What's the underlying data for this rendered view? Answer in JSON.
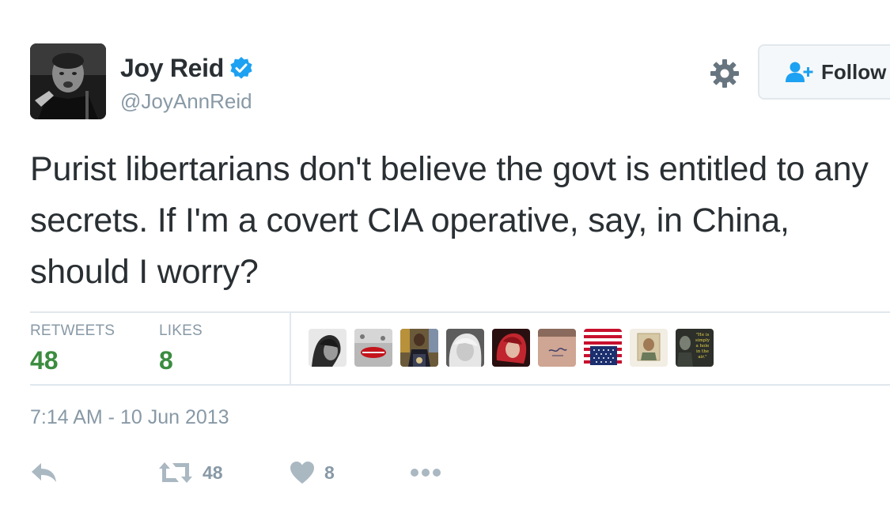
{
  "author": {
    "display_name": "Joy Reid",
    "handle": "@JoyAnnReid",
    "verified": true
  },
  "header": {
    "follow_label": "Follow"
  },
  "tweet": {
    "text": "Purist libertarians don't believe the govt is entitled to any secrets. If I'm a covert CIA operative, say, in China, should I worry?",
    "timestamp": "7:14 AM - 10 Jun 2013"
  },
  "stats": {
    "retweets_label": "RETWEETS",
    "retweets_value": "48",
    "likes_label": "LIKES",
    "likes_value": "8"
  },
  "likers": [
    {
      "icon": "liker-avatar-bw-portrait"
    },
    {
      "icon": "liker-avatar-red-lips"
    },
    {
      "icon": "liker-avatar-podium-speaker"
    },
    {
      "icon": "liker-avatar-blonde-woman"
    },
    {
      "icon": "liker-avatar-red-hair"
    },
    {
      "icon": "liker-avatar-back-tattoo"
    },
    {
      "icon": "liker-avatar-us-flag"
    },
    {
      "icon": "liker-avatar-vintage-portrait"
    },
    {
      "icon": "liker-avatar-quote-photo",
      "text": "\"He is simply a hole in the air.\""
    }
  ],
  "actions": {
    "retweet_count": "48",
    "like_count": "8"
  },
  "colors": {
    "accent_blue": "#1da1f2",
    "stat_green": "#3b8c3f",
    "muted_gray": "#8899a6",
    "text_dark": "#292f33",
    "divider": "#e1e8ed"
  }
}
